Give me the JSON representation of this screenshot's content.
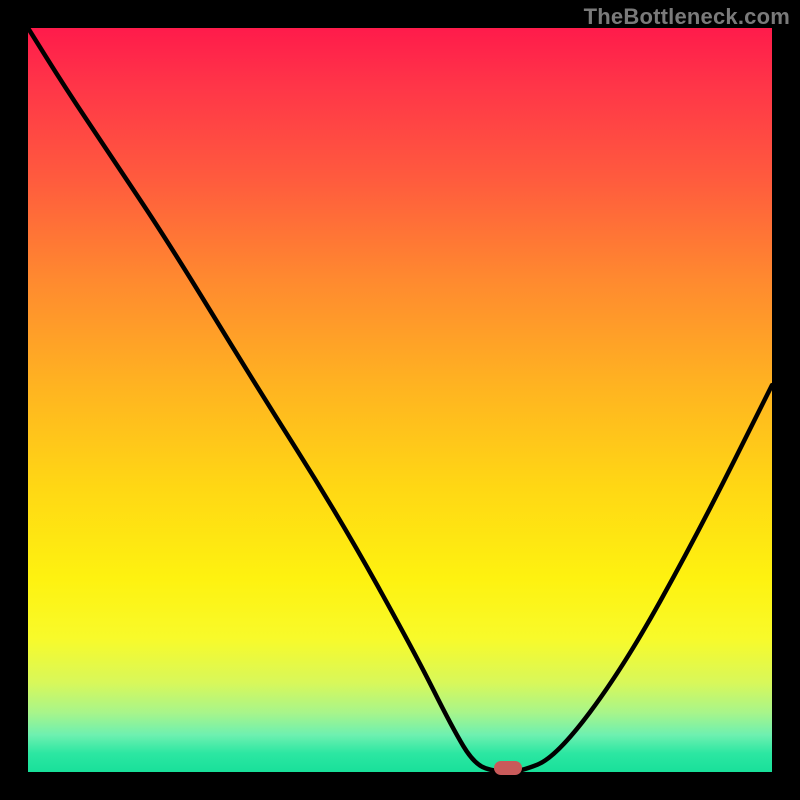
{
  "watermark": "TheBottleneck.com",
  "chart_data": {
    "type": "line",
    "title": "",
    "xlabel": "",
    "ylabel": "",
    "xlim": [
      0,
      100
    ],
    "ylim": [
      0,
      100
    ],
    "series": [
      {
        "name": "curve",
        "x": [
          0,
          5,
          11,
          19,
          30,
          42,
          52,
          57,
          60,
          63,
          66,
          71,
          80,
          90,
          100
        ],
        "y": [
          100,
          92,
          83,
          71,
          53,
          34,
          16,
          6,
          1,
          0,
          0,
          2,
          14,
          32,
          52
        ]
      }
    ],
    "marker": {
      "x": 64.5,
      "y": 0.5
    },
    "gradient_stops": [
      {
        "pos": 0,
        "color": "#ff1b4b"
      },
      {
        "pos": 0.5,
        "color": "#ffd814"
      },
      {
        "pos": 0.97,
        "color": "#2ce7a2"
      },
      {
        "pos": 1,
        "color": "#18e09a"
      }
    ],
    "colors": {
      "frame": "#000000",
      "curve": "#000000",
      "marker": "#c95a5a",
      "watermark": "#7a7a7a"
    }
  }
}
